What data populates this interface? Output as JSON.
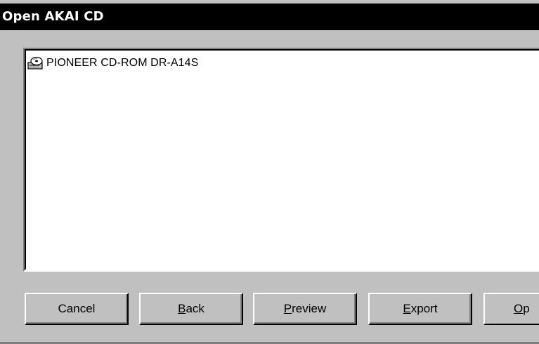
{
  "window": {
    "title": "Open AKAI CD"
  },
  "drive_list": {
    "items": [
      {
        "label": "PIONEER CD-ROM DR-A14S",
        "icon": "cd-drive-icon"
      }
    ]
  },
  "buttons": {
    "cancel": {
      "label": "Cancel"
    },
    "back": {
      "mnemonic": "B",
      "rest": "ack"
    },
    "preview": {
      "mnemonic": "P",
      "rest": "review"
    },
    "export": {
      "mnemonic": "E",
      "rest": "xport"
    },
    "open": {
      "mnemonic": "O",
      "rest": "p"
    }
  },
  "colors": {
    "face": "#c0c0c0",
    "titlebar": "#000000",
    "list_bg": "#ffffff"
  }
}
